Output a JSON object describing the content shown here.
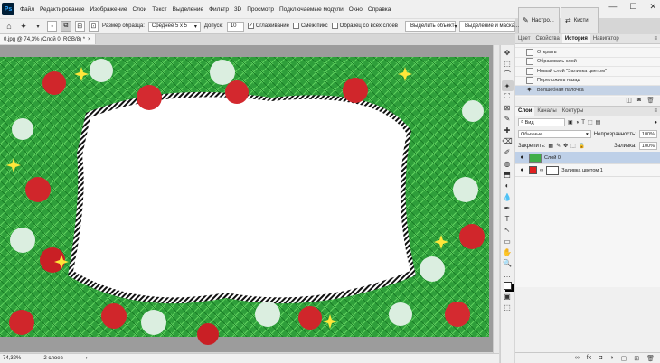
{
  "app": {
    "logo": "Ps"
  },
  "menu": [
    "Файл",
    "Редактирование",
    "Изображение",
    "Слои",
    "Текст",
    "Выделение",
    "Фильтр",
    "3D",
    "Просмотр",
    "Подключаемые модули",
    "Окно",
    "Справка"
  ],
  "window_controls": {
    "minimize": "—",
    "maximize": "☐",
    "close": "✕"
  },
  "options": {
    "sample_size_label": "Размер образца:",
    "sample_size_value": "Среднее 5 x 5",
    "tolerance_label": "Допуск:",
    "tolerance_value": "10",
    "anti_alias": "Сглаживание",
    "contiguous": "Смеж.пикс",
    "sample_all": "Образец со всех слоев",
    "select_subject": "Выделить объект",
    "select_mask": "Выделение и маска..."
  },
  "floating_panels": [
    {
      "label": "Настро...",
      "icon": "adjust-brush-icon"
    },
    {
      "label": "Кисти",
      "icon": "brushes-icon"
    }
  ],
  "document": {
    "tab": "0.jpg @ 74,3% (Слой 0, RGB/8) *",
    "close": "×"
  },
  "status": {
    "zoom": "74,32%",
    "info": "2 слоев"
  },
  "tools": [
    "✥",
    "⬚",
    "⌒",
    "✦",
    "⛶",
    "⊠",
    "✎",
    "✚",
    "⌫",
    "✐",
    "◍",
    "⬒",
    "◐",
    "💧",
    "✒",
    "T",
    "↖",
    "▭",
    "✋",
    "🔍",
    "…",
    "⬓",
    "▣",
    "⬚"
  ],
  "right_panel": {
    "top_tabs": [
      "Цвет",
      "Свойства",
      "История",
      "Навигатор"
    ],
    "active_top_tab": 2,
    "history": [
      "Открыть",
      "Образовать слой",
      "Новый слой \"Заливка цветом\"",
      "Переложить назад",
      "Волшебная палочка"
    ],
    "active_history": 4,
    "layer_tabs": [
      "Слои",
      "Каналы",
      "Контуры"
    ],
    "active_layer_tab": 0,
    "kind_label": "Вид",
    "blend_mode": "Обычные",
    "opacity_label": "Непрозрачность:",
    "opacity_value": "100%",
    "lock_label": "Закрепить:",
    "fill_label": "Заливка:",
    "fill_value": "100%",
    "layers": [
      {
        "name": "Слой 0",
        "selected": true
      },
      {
        "name": "Заливка цветом 1",
        "selected": false
      }
    ],
    "footer_icons": [
      "∞",
      "fx",
      "◘",
      "◑",
      "▢",
      "⊞",
      "🗑"
    ]
  },
  "colors": {
    "selected_row": "#c5d3e6",
    "fill_layer_red": "#e02020",
    "pine_green": "#2e9e3a"
  }
}
